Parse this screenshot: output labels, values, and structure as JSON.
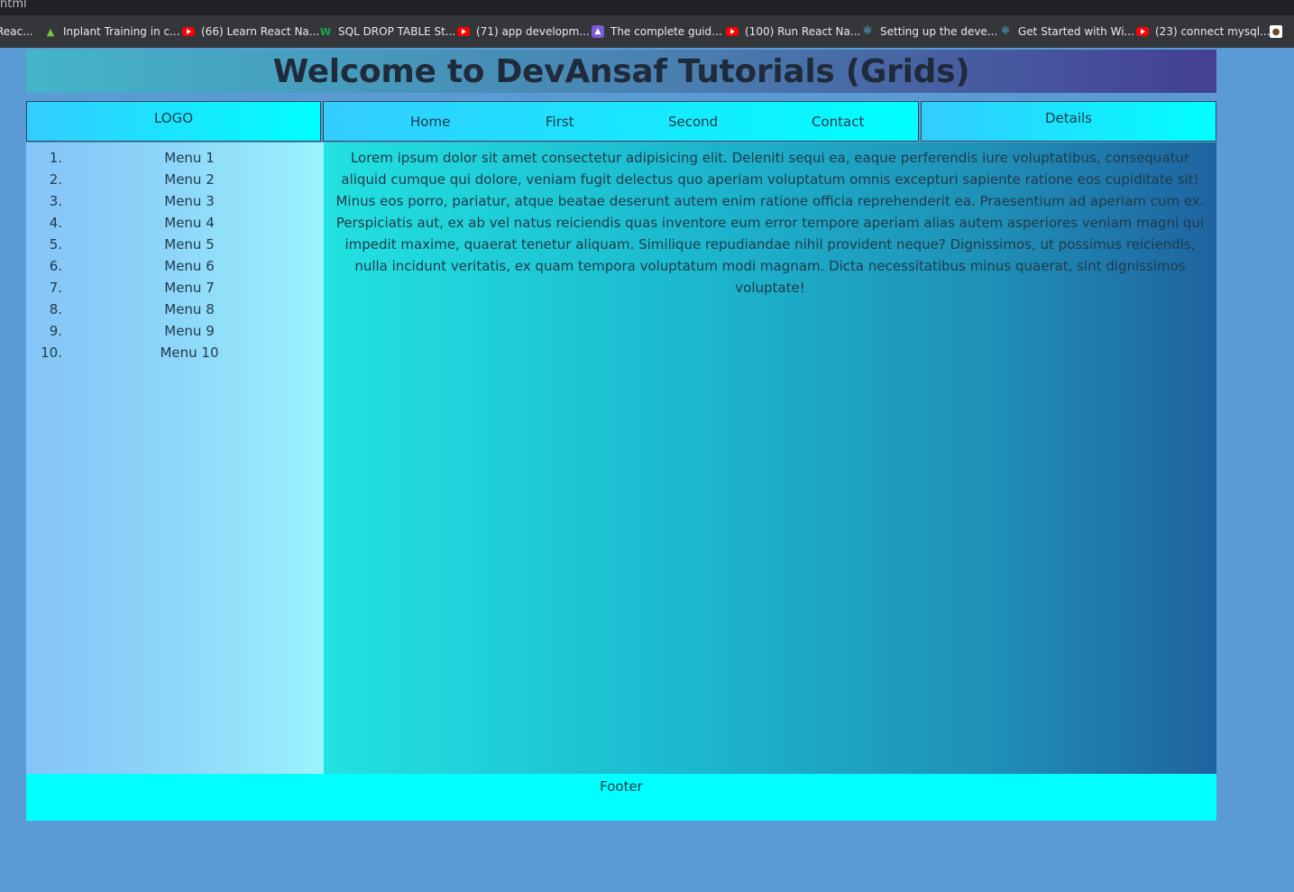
{
  "topbar": {
    "title": "html"
  },
  "bookmarks": [
    {
      "label": "Reac...",
      "icon": "blank-icon"
    },
    {
      "label": "Inplant Training in c...",
      "icon": "chart-icon"
    },
    {
      "label": "(66) Learn React Na...",
      "icon": "youtube-icon"
    },
    {
      "label": "SQL DROP TABLE St...",
      "icon": "w3schools-icon"
    },
    {
      "label": "(71) app developm...",
      "icon": "youtube-icon"
    },
    {
      "label": "The complete guid...",
      "icon": "rocket-icon"
    },
    {
      "label": "(100) Run React Na...",
      "icon": "youtube-icon"
    },
    {
      "label": "Setting up the deve...",
      "icon": "react-icon"
    },
    {
      "label": "Get Started with Wi...",
      "icon": "react-icon"
    },
    {
      "label": "(23) connect mysql...",
      "icon": "youtube-icon"
    }
  ],
  "header": {
    "title": "Welcome to DevAnsaf Tutorials (Grids)"
  },
  "logo": {
    "label": "LOGO"
  },
  "nav": {
    "home": "Home",
    "first": "First",
    "second": "Second",
    "contact": "Contact"
  },
  "details": {
    "label": "Details"
  },
  "sidebar": {
    "items": [
      {
        "num": "1.",
        "label": "Menu 1"
      },
      {
        "num": "2.",
        "label": "Menu 2"
      },
      {
        "num": "3.",
        "label": "Menu 3"
      },
      {
        "num": "4.",
        "label": "Menu 4"
      },
      {
        "num": "5.",
        "label": "Menu 5"
      },
      {
        "num": "6.",
        "label": "Menu 6"
      },
      {
        "num": "7.",
        "label": "Menu 7"
      },
      {
        "num": "8.",
        "label": "Menu 8"
      },
      {
        "num": "9.",
        "label": "Menu 9"
      },
      {
        "num": "10.",
        "label": "Menu 10"
      }
    ]
  },
  "content": {
    "text": "Lorem ipsum dolor sit amet consectetur adipisicing elit. Deleniti sequi ea, eaque perferendis iure voluptatibus, consequatur aliquid cumque qui dolore, veniam fugit delectus quo aperiam voluptatum omnis excepturi sapiente ratione eos cupiditate sit! Minus eos porro, pariatur, atque beatae deserunt autem enim ratione officia reprehenderit ea. Praesentium ad aperiam cum ex. Perspiciatis aut, ex ab vel natus reiciendis quas inventore eum error tempore aperiam alias autem asperiores veniam magni qui impedit maxime, quaerat tenetur aliquam. Similique repudiandae nihil provident neque? Dignissimos, ut possimus reiciendis, nulla incidunt veritatis, ex quam tempora voluptatum modi magnam. Dicta necessitatibus minus quaerat, sint dignissimos voluptate!"
  },
  "footer": {
    "label": "Footer"
  },
  "colors": {
    "page_bg": "#5b9bd5",
    "cyan": "#00ffff",
    "header_text": "#1f2b3a"
  }
}
